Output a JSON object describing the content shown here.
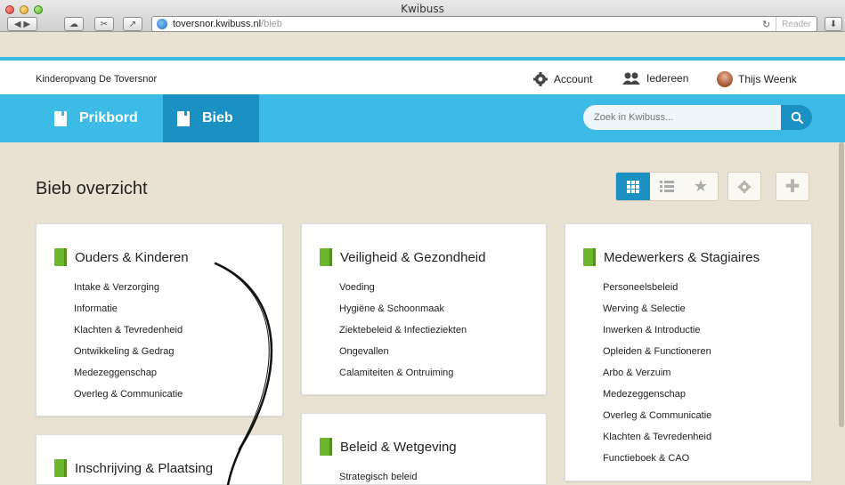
{
  "window": {
    "title": "Kwibuss"
  },
  "browser": {
    "url_host": "toversnor.kwibuss.nl",
    "url_path": "/bieb",
    "reader_label": "Reader"
  },
  "topbar": {
    "org_name": "Kinderopvang De Toversnor",
    "account_label": "Account",
    "everyone_label": "Iedereen",
    "user_name": "Thijs Weenk"
  },
  "nav": {
    "tabs": [
      {
        "label": "Prikbord"
      },
      {
        "label": "Bieb"
      }
    ],
    "search_placeholder": "Zoek in Kwibuss..."
  },
  "page": {
    "title": "Bieb overzicht"
  },
  "cards": [
    {
      "title": "Ouders & Kinderen",
      "items": [
        "Intake & Verzorging",
        "Informatie",
        "Klachten & Tevredenheid",
        "Ontwikkeling & Gedrag",
        "Medezeggenschap",
        "Overleg & Communicatie"
      ]
    },
    {
      "title": "Veiligheid & Gezondheid",
      "items": [
        "Voeding",
        "Hygiëne & Schoonmaak",
        "Ziektebeleid & Infectieziekten",
        "Ongevallen",
        "Calamiteiten & Ontruiming"
      ]
    },
    {
      "title": "Medewerkers & Stagiaires",
      "items": [
        "Personeelsbeleid",
        "Werving & Selectie",
        "Inwerken & Introductie",
        "Opleiden & Functioneren",
        "Arbo & Verzuim",
        "Medezeggenschap",
        "Overleg & Communicatie",
        "Klachten & Tevredenheid",
        "Functieboek & CAO"
      ]
    },
    {
      "title": "Inschrijving & Plaatsing",
      "items": []
    },
    {
      "title": "Beleid & Wetgeving",
      "items": [
        "Strategisch beleid"
      ]
    }
  ],
  "colors": {
    "brand_blue": "#3dbbe7",
    "active_blue": "#1a91c2",
    "book_green": "#6cb52d",
    "page_bg": "#e9e2d2"
  }
}
